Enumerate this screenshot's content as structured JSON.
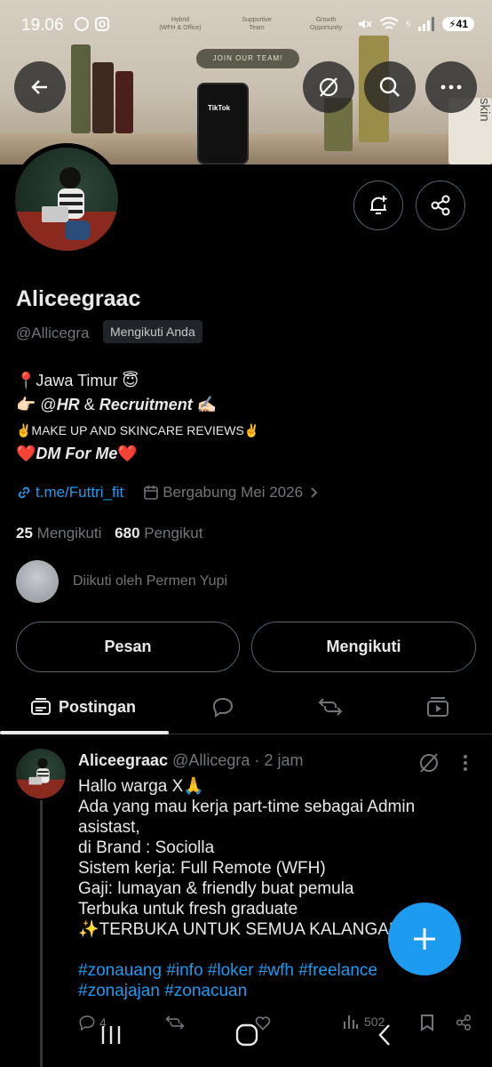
{
  "status_bar": {
    "time": "19.06",
    "battery": "41",
    "signal_label": "5"
  },
  "banner": {
    "wall_items": [
      "Hybrid",
      "(WFH & Office)",
      "Supportive",
      "Team",
      "Growth",
      "Opportunity"
    ],
    "join_label": "JOIN OUR TEAM!",
    "phone_label": "TikTok",
    "product_label": "skin"
  },
  "profile": {
    "name": "Aliceegraac",
    "handle": "@Allicegra",
    "follows_you": "Mengikuti Anda",
    "bio": {
      "line1": "📍Jawa Timur 😇",
      "line2_prefix": "👉🏻 @",
      "line2_hr": "HR",
      "line2_amp": " & ",
      "line2_rec": "Recruitment",
      "line2_suffix": " ✍🏻",
      "line3": "✌️MAKE UP AND SKINCARE REVIEWS✌️",
      "line4_pre": "❤️",
      "line4_dm": "DM For Me",
      "line4_post": "❤️"
    },
    "link": "t.me/Futtri_fit",
    "joined": "Bergabung Mei 2026",
    "following_count": "25",
    "following_label": "Mengikuti",
    "followers_count": "680",
    "followers_label": "Pengikut",
    "followed_by": "Diikuti oleh Permen Yupi",
    "message_button": "Pesan",
    "follow_button": "Mengikuti"
  },
  "tabs": {
    "posts": "Postingan"
  },
  "tweet": {
    "name": "Aliceegraac",
    "handle": "@Allicegra",
    "sep": "·",
    "time": "2 jam",
    "lines": [
      "Hallo warga X🙏",
      "Ada yang mau kerja part-time sebagai Admin",
      "asistast,",
      "di Brand : Sociolla",
      "Sistem kerja: Full Remote (WFH)",
      "Gaji: lumayan & friendly buat pemula",
      "Terbuka untuk fresh graduate",
      "✨TERBUKA UNTUK SEMUA KALANGAN"
    ],
    "hashtags_line1": "#zonauang #info #loker #wfh #freelance",
    "hashtags_line2": "#zonajajan #zonacuan",
    "reply_count": "4",
    "views_count": "502"
  },
  "colors": {
    "accent": "#1d9bf0",
    "background": "#000000",
    "muted": "#71767b"
  }
}
